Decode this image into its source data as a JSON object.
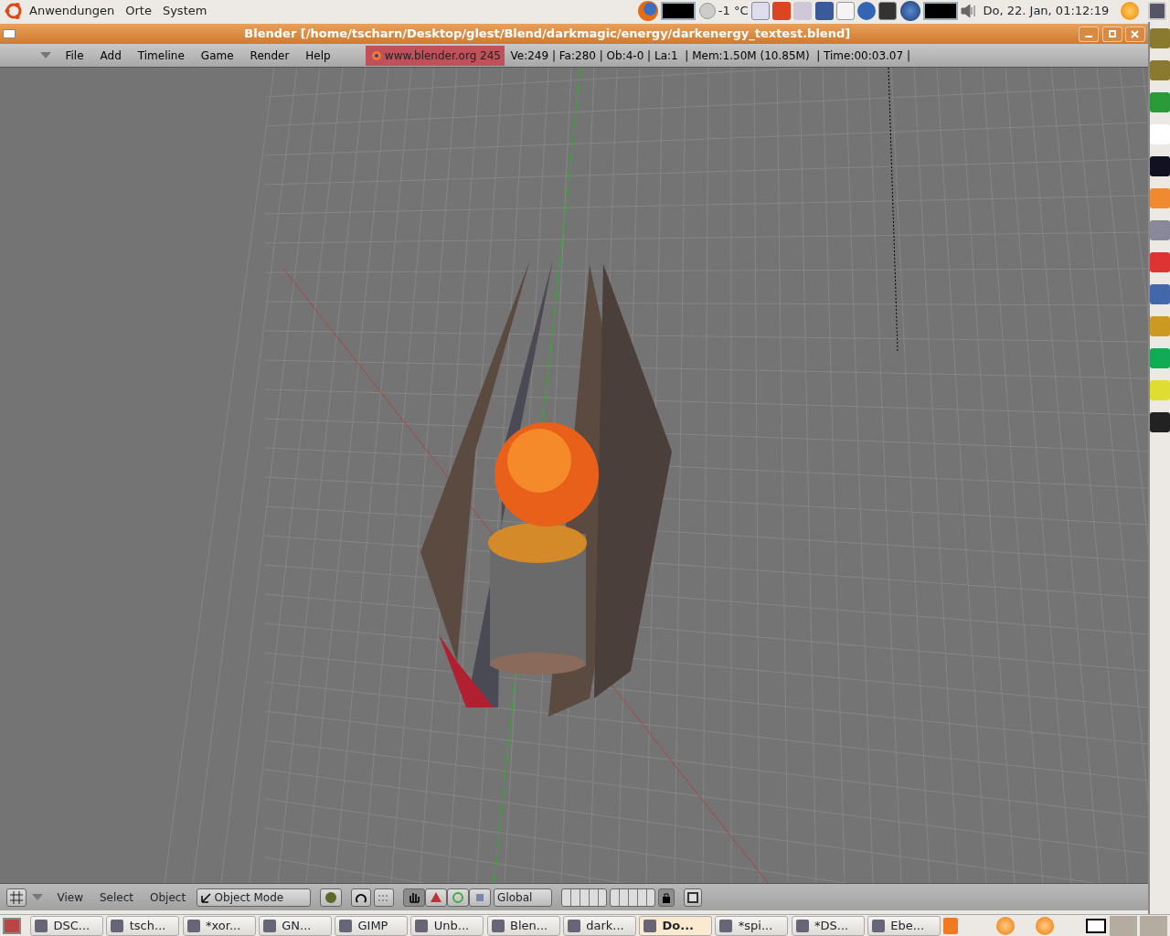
{
  "top_panel": {
    "menus": [
      "Anwendungen",
      "Orte",
      "System"
    ],
    "temperature": "-1 °C",
    "clock": "Do, 22. Jan, 01:12:19"
  },
  "window": {
    "title": "Blender [/home/tscharn/Desktop/glest/Blend/darkmagic/energy/darkenergy_textest.blend]"
  },
  "blender_header": {
    "menus": [
      "File",
      "Add",
      "Timeline",
      "Game",
      "Render",
      "Help"
    ],
    "version_label": "www.blender.org 245",
    "stats": "Ve:249 | Fa:280 | Ob:4-0 | La:1  | Mem:1.50M (10.85M)  | Time:00:03.07 |"
  },
  "view3d_header": {
    "menus": [
      "View",
      "Select",
      "Object"
    ],
    "mode": "Object Mode",
    "orientation": "Global",
    "manipulators": [
      {
        "kind": "hand",
        "selected": true
      },
      {
        "kind": "translate",
        "selected": false
      },
      {
        "kind": "rotate",
        "selected": false
      },
      {
        "kind": "scale",
        "selected": false
      }
    ],
    "lock_selected": true
  },
  "taskbar": {
    "items": [
      {
        "label": "DSC...",
        "selected": false
      },
      {
        "label": "tsch...",
        "selected": false
      },
      {
        "label": "*xor...",
        "selected": false
      },
      {
        "label": "GN...",
        "selected": false
      },
      {
        "label": "GIMP",
        "selected": false
      },
      {
        "label": "Unb...",
        "selected": false
      },
      {
        "label": "Blen...",
        "selected": false
      },
      {
        "label": "dark...",
        "selected": false
      },
      {
        "label": "Do...",
        "selected": true
      },
      {
        "label": "*spi...",
        "selected": false
      },
      {
        "label": "*DS...",
        "selected": false
      },
      {
        "label": "Ebe...",
        "selected": false
      }
    ]
  }
}
